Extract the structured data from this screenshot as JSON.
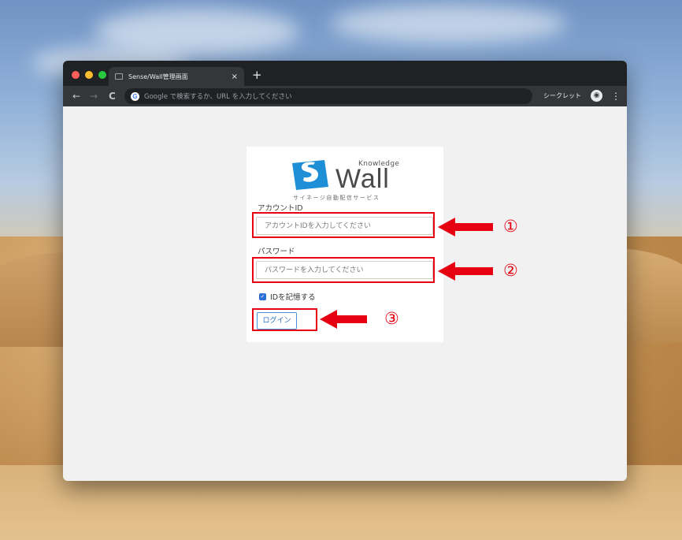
{
  "browser": {
    "tab_title": "Sense/Wall管理画面",
    "tab_close": "×",
    "new_tab": "+",
    "back": "←",
    "forward": "→",
    "reload": "C",
    "omnibox_icon": "G",
    "omnibox_placeholder": "Google で検索するか、URL を入力してください",
    "incognito_label": "シークレット",
    "incognito_icon": "incognito-icon",
    "menu": "⋮"
  },
  "logo": {
    "knowledge": "Knowledge",
    "wall": "Wall",
    "subtitle": "サイネージ自動配信サービス"
  },
  "form": {
    "account_label": "アカウントID",
    "account_placeholder": "アカウントIDを入力してください",
    "password_label": "パスワード",
    "password_placeholder": "パスワードを入力してください",
    "remember_label": "IDを記憶する",
    "remember_checked": true,
    "login_label": "ログイン"
  },
  "annotations": {
    "n1": "①",
    "n2": "②",
    "n3": "③",
    "color": "#e60012"
  }
}
